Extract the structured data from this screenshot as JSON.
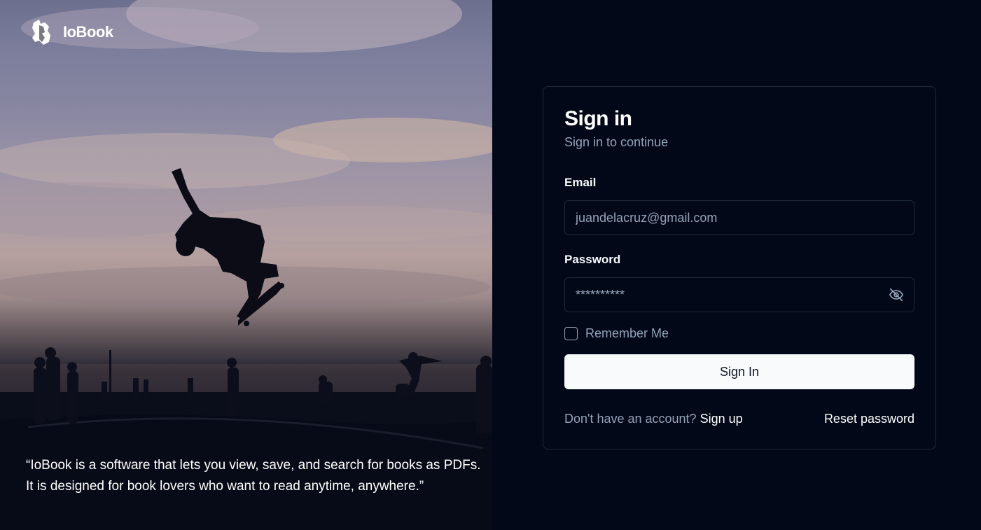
{
  "brand": {
    "name": "IoBook",
    "logo_icon": "book-logo-icon"
  },
  "hero": {
    "quote": "“IoBook is a software that lets you view, save, and search for books as PDFs. It is designed for book lovers who want to read anytime, anywhere.”"
  },
  "signin": {
    "title": "Sign in",
    "subtitle": "Sign in to continue",
    "email_label": "Email",
    "email_value": "juandelacruz@gmail.com",
    "password_label": "Password",
    "password_value": "**********",
    "password_toggle_icon": "eye-off-icon",
    "remember_label": "Remember Me",
    "remember_checked": false,
    "submit_label": "Sign In",
    "no_account_text": "Don't have an account?",
    "signup_link": "Sign up",
    "reset_link": "Reset password"
  },
  "colors": {
    "background": "#020817",
    "card_border": "#1e293b",
    "muted_text": "#94a3b8",
    "button_bg": "#f8fafc",
    "button_text": "#0f172a"
  }
}
